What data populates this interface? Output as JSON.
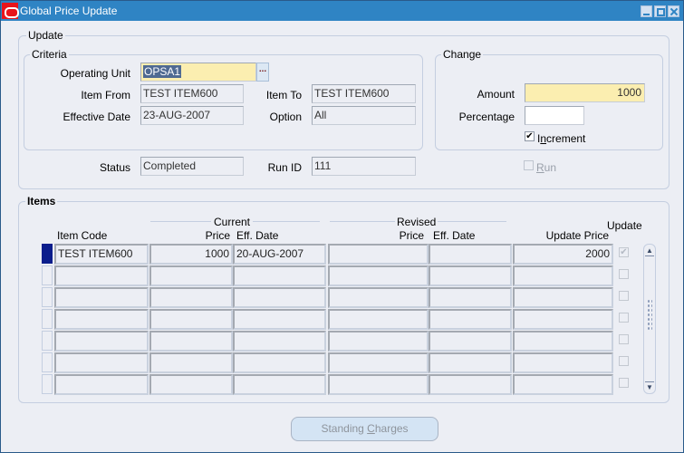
{
  "window": {
    "title": "Global Price Update",
    "controls": [
      "minimize",
      "maximize",
      "close"
    ]
  },
  "update_group": {
    "label": "Update",
    "criteria": {
      "label": "Criteria",
      "operating_unit": {
        "label": "Operating Unit",
        "value": "OPSA1"
      },
      "item_from": {
        "label": "Item  From",
        "value": "TEST ITEM600"
      },
      "item_to": {
        "label": "Item To",
        "value": "TEST ITEM600"
      },
      "effective_date": {
        "label": "Effective Date",
        "value": "23-AUG-2007"
      },
      "option": {
        "label": "Option",
        "value": "All"
      },
      "lov_button": "..."
    },
    "change": {
      "label": "Change",
      "amount": {
        "label": "Amount",
        "value": "1000"
      },
      "percentage": {
        "label": "Percentage",
        "value": ""
      },
      "increment": {
        "label_pre": "I",
        "label_mnemonic": "n",
        "label_post": "crement",
        "checked": true
      }
    },
    "status": {
      "label": "Status",
      "value": "Completed"
    },
    "run_id": {
      "label": "Run ID",
      "value": "111"
    },
    "run": {
      "label_mnemonic": "R",
      "label_post": "un",
      "checked": false,
      "enabled": false
    }
  },
  "items": {
    "label": "Items",
    "group_headers": {
      "current": "Current",
      "revised": "Revised"
    },
    "columns": {
      "item_code": "Item Code",
      "current_price": "Price",
      "current_eff_date": "Eff. Date",
      "revised_price": "Price",
      "revised_eff_date": "Eff. Date",
      "update_price": "Update Price",
      "update": "Update"
    },
    "rows": [
      {
        "item_code": "TEST ITEM600",
        "current_price": "1000",
        "current_eff_date": "20-AUG-2007",
        "revised_price": "",
        "revised_eff_date": "",
        "update_price": "2000",
        "update": true
      },
      {
        "item_code": "",
        "current_price": "",
        "current_eff_date": "",
        "revised_price": "",
        "revised_eff_date": "",
        "update_price": "",
        "update": false
      },
      {
        "item_code": "",
        "current_price": "",
        "current_eff_date": "",
        "revised_price": "",
        "revised_eff_date": "",
        "update_price": "",
        "update": false
      },
      {
        "item_code": "",
        "current_price": "",
        "current_eff_date": "",
        "revised_price": "",
        "revised_eff_date": "",
        "update_price": "",
        "update": false
      },
      {
        "item_code": "",
        "current_price": "",
        "current_eff_date": "",
        "revised_price": "",
        "revised_eff_date": "",
        "update_price": "",
        "update": false
      },
      {
        "item_code": "",
        "current_price": "",
        "current_eff_date": "",
        "revised_price": "",
        "revised_eff_date": "",
        "update_price": "",
        "update": false
      },
      {
        "item_code": "",
        "current_price": "",
        "current_eff_date": "",
        "revised_price": "",
        "revised_eff_date": "",
        "update_price": "",
        "update": false
      }
    ]
  },
  "buttons": {
    "standing_charges": {
      "label_pre": "Standing ",
      "label_mnemonic": "C",
      "label_post": "harges",
      "enabled": false
    }
  }
}
